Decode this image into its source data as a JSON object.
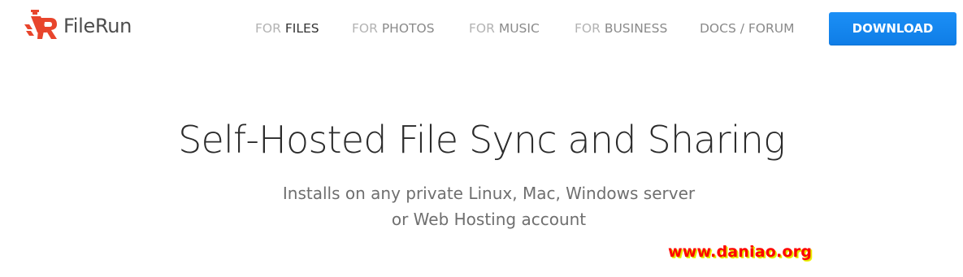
{
  "brand": {
    "name": "FileRun",
    "accent_color": "#e8452c",
    "icon": "filerun-logo-icon"
  },
  "nav": {
    "items": [
      {
        "prefix": "FOR",
        "label": "FILES",
        "active": true
      },
      {
        "prefix": "FOR",
        "label": "PHOTOS",
        "active": false
      },
      {
        "prefix": "FOR",
        "label": "MUSIC",
        "active": false
      },
      {
        "prefix": "FOR",
        "label": "BUSINESS",
        "active": false
      }
    ],
    "docs_label": "DOCS / FORUM",
    "download_label": "DOWNLOAD",
    "download_color": "#1487f0"
  },
  "hero": {
    "title": "Self-Hosted File Sync and Sharing",
    "subtitle_line1": "Installs on any private Linux, Mac, Windows server",
    "subtitle_line2": "or Web Hosting account"
  },
  "watermark": {
    "text": "www.daniao.org",
    "color": "#ff0000"
  }
}
